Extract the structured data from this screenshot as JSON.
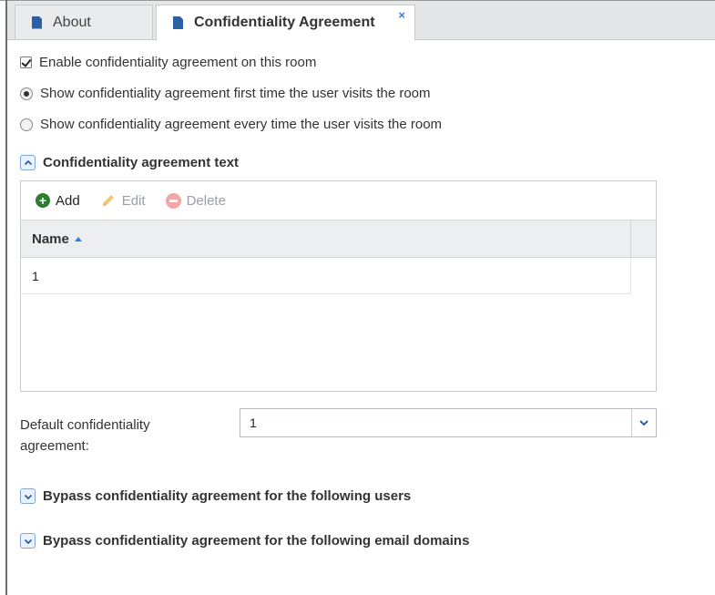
{
  "tabs": [
    {
      "label": "About"
    },
    {
      "label": "Confidentiality Agreement",
      "close": "×"
    }
  ],
  "options": {
    "enable": {
      "label": "Enable confidentiality agreement on this room",
      "checked": true
    },
    "first_time": {
      "label": "Show confidentiality agreement first time the user visits the room",
      "selected": true
    },
    "every_time": {
      "label": "Show confidentiality agreement every time the user visits the room",
      "selected": false
    }
  },
  "agreement_section": {
    "title": "Confidentiality agreement text",
    "expanded": true
  },
  "toolbar": {
    "add": "Add",
    "edit": "Edit",
    "delete": "Delete"
  },
  "grid": {
    "columns": [
      {
        "label": "Name",
        "sort": "ascending"
      }
    ],
    "rows": [
      {
        "name": "1"
      }
    ]
  },
  "default_agreement": {
    "label": "Default confidentiality agreement:",
    "value": "1"
  },
  "bypass_users": {
    "title": "Bypass confidentiality agreement for the following users",
    "expanded": false
  },
  "bypass_domains": {
    "title": "Bypass confidentiality agreement for the following email domains",
    "expanded": false
  },
  "colors": {
    "accent": "#3a7bd5",
    "add_green": "#2e7d32",
    "delete_red": "#f4a5a5",
    "doc_icon": "#2b5fa6"
  }
}
